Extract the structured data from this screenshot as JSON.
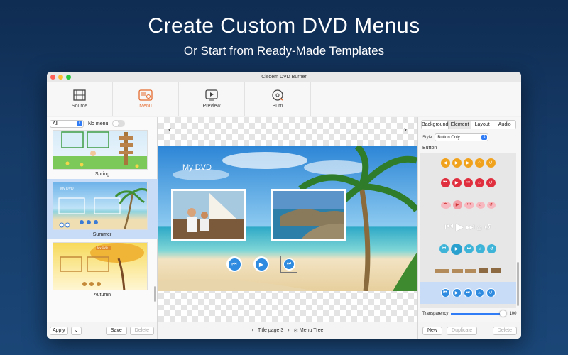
{
  "hero": {
    "title": "Create Custom DVD Menus",
    "subtitle": "Or Start from Ready-Made Templates"
  },
  "window": {
    "title": "Cisdem DVD Burner"
  },
  "toolbar": {
    "items": [
      {
        "label": "Source",
        "icon": "film-icon"
      },
      {
        "label": "Menu",
        "icon": "menu-icon"
      },
      {
        "label": "Preview",
        "icon": "play-icon"
      },
      {
        "label": "Burn",
        "icon": "disc-icon"
      }
    ]
  },
  "left": {
    "filter_value": "All",
    "no_menu_label": "No menu",
    "templates": [
      {
        "label": "Spring"
      },
      {
        "label": "Summer",
        "thumb_title": "My DVD"
      },
      {
        "label": "Autumn",
        "thumb_title": "My DVD"
      }
    ],
    "apply_label": "Apply",
    "save_label": "Save",
    "delete_label": "Delete"
  },
  "center": {
    "menu_title": "My DVD",
    "page_label": "Title page 3",
    "menu_tree_label": "Menu Tree"
  },
  "right": {
    "tabs": [
      "Background",
      "Element",
      "Layout",
      "Audio"
    ],
    "style_label": "Style",
    "style_value": "Button Only",
    "section_label": "Button",
    "transparency_label": "Transparency",
    "transparency_value": "100",
    "new_label": "New",
    "duplicate_label": "Duplicate",
    "delete_label": "Delete"
  },
  "colors": {
    "accent": "#2f7cf6",
    "active_tool": "#e56b2e"
  }
}
